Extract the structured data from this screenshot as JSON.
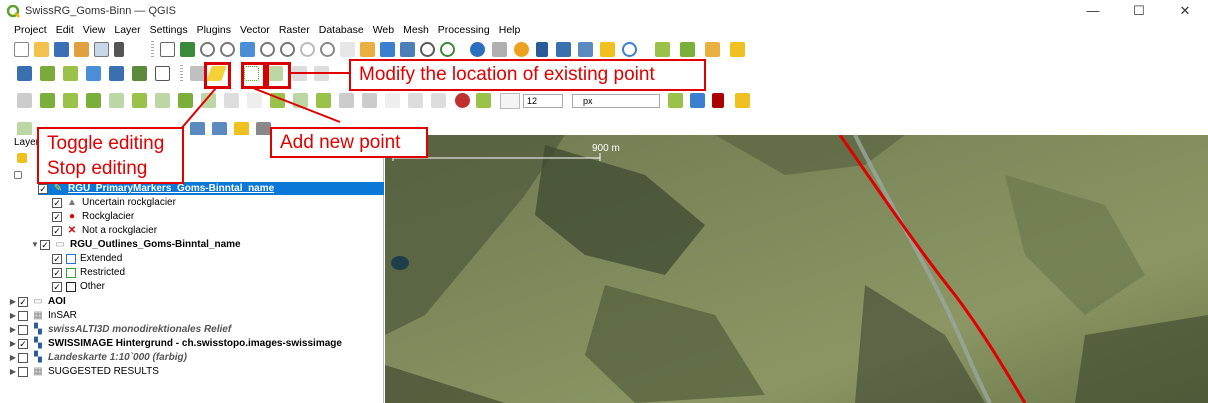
{
  "window": {
    "title": "SwissRG_Goms-Binn — QGIS",
    "controls": [
      "—",
      "☐",
      "✕"
    ]
  },
  "menubar": [
    "Project",
    "Edit",
    "View",
    "Layer",
    "Settings",
    "Plugins",
    "Vector",
    "Raster",
    "Database",
    "Web",
    "Mesh",
    "Processing",
    "Help"
  ],
  "toolbar": {
    "font_size_value": "12",
    "unit_value": "px"
  },
  "layers_panel": {
    "title": "Layer",
    "tree": [
      {
        "label": "RGU_PrimaryMarkers_Goms-Binntal_name",
        "checked": true,
        "selected": true
      },
      {
        "label": "Uncertain rockglacier",
        "checked": true
      },
      {
        "label": "Rockglacier",
        "checked": true
      },
      {
        "label": "Not a rockglacier",
        "checked": true
      },
      {
        "label": "RGU_Outlines_Goms-Binntal_name",
        "checked": true
      },
      {
        "label": "Extended",
        "checked": true
      },
      {
        "label": "Restricted",
        "checked": true
      },
      {
        "label": "Other",
        "checked": true
      },
      {
        "label": "AOI",
        "checked": true
      },
      {
        "label": "InSAR",
        "checked": false
      },
      {
        "label": "swissALTI3D monodirektionales Relief",
        "checked": false
      },
      {
        "label": "SWISSIMAGE Hintergrund - ch.swisstopo.images-swissimage",
        "checked": true
      },
      {
        "label": "Landeskarte 1:10`000 (farbig)",
        "checked": false
      },
      {
        "label": "SUGGESTED RESULTS",
        "checked": false
      }
    ]
  },
  "map": {
    "scale_label": "900 m"
  },
  "annotations": {
    "modify": "Modify the location of existing point",
    "add": "Add new point",
    "toggle_line1": "Toggle editing",
    "toggle_line2": "Stop editing"
  },
  "colors": {
    "annotation": "#e00000",
    "selection": "#0a78d7",
    "qgis_green": "#5aa02c"
  }
}
